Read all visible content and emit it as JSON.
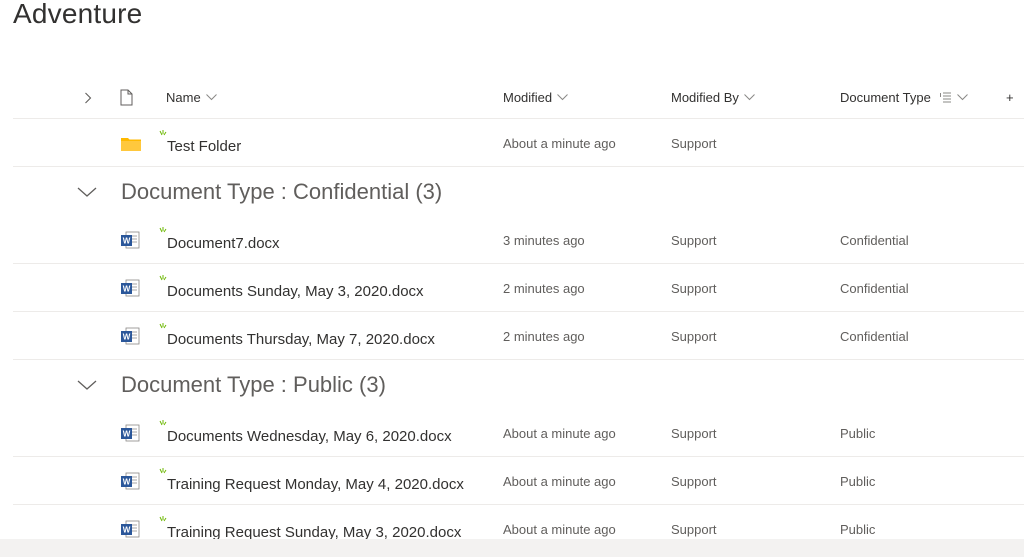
{
  "page": {
    "title": "Adventure"
  },
  "columns": {
    "name": "Name",
    "modified": "Modified",
    "modified_by": "Modified By",
    "document_type": "Document Type",
    "add": "+"
  },
  "folder": {
    "name": "Test Folder",
    "modified": "About a minute ago",
    "modified_by": "Support",
    "document_type": ""
  },
  "groups": [
    {
      "label": "Document Type : Confidential (3)",
      "items": [
        {
          "name": "Document7.docx",
          "modified": "3 minutes ago",
          "modified_by": "Support",
          "document_type": "Confidential"
        },
        {
          "name": "Documents Sunday, May 3, 2020.docx",
          "modified": "2 minutes ago",
          "modified_by": "Support",
          "document_type": "Confidential"
        },
        {
          "name": "Documents Thursday, May 7, 2020.docx",
          "modified": "2 minutes ago",
          "modified_by": "Support",
          "document_type": "Confidential"
        }
      ]
    },
    {
      "label": "Document Type : Public (3)",
      "items": [
        {
          "name": "Documents Wednesday, May 6, 2020.docx",
          "modified": "About a minute ago",
          "modified_by": "Support",
          "document_type": "Public"
        },
        {
          "name": "Training Request Monday, May 4, 2020.docx",
          "modified": "About a minute ago",
          "modified_by": "Support",
          "document_type": "Public"
        },
        {
          "name": "Training Request Sunday, May 3, 2020.docx",
          "modified": "About a minute ago",
          "modified_by": "Support",
          "document_type": "Public"
        }
      ]
    }
  ],
  "colors": {
    "folder": "#ffb900",
    "word": "#2b579a",
    "new_mark": "#6bb700"
  }
}
